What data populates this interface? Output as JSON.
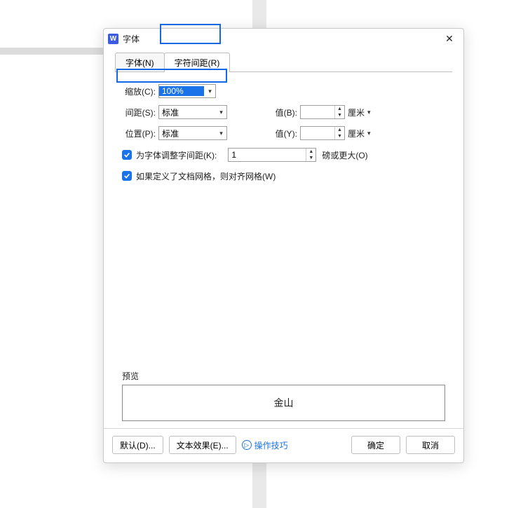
{
  "window": {
    "title": "字体",
    "app_glyph": "W"
  },
  "tabs": {
    "font": "字体(N)",
    "spacing": "字符间距(R)"
  },
  "form": {
    "scale_label": "缩放(C):",
    "scale_value": "100%",
    "spacing_label": "间距(S):",
    "spacing_value": "标准",
    "spacing_val_label": "值(B):",
    "spacing_val_value": "",
    "spacing_unit": "厘米",
    "position_label": "位置(P):",
    "position_value": "标准",
    "position_val_label": "值(Y):",
    "position_val_value": "",
    "position_unit": "厘米",
    "kerning_label": "为字体调整字间距(K):",
    "kerning_value": "1",
    "kerning_unit_label": "磅或更大(O)",
    "snap_label": "如果定义了文档网格，则对齐网格(W)"
  },
  "preview": {
    "title": "预览",
    "sample": "金山"
  },
  "buttons": {
    "default": "默认(D)...",
    "text_effects": "文本效果(E)...",
    "tips": "操作技巧",
    "ok": "确定",
    "cancel": "取消"
  }
}
